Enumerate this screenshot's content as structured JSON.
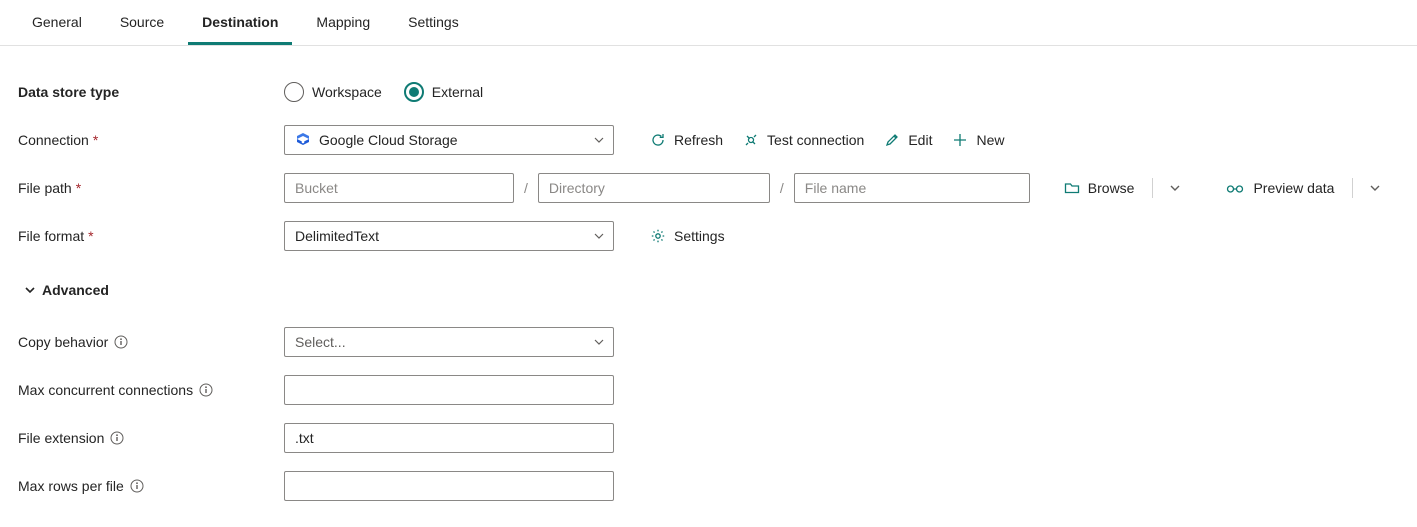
{
  "tabs": [
    "General",
    "Source",
    "Destination",
    "Mapping",
    "Settings"
  ],
  "active_tab_index": 2,
  "form": {
    "data_store_type": {
      "label": "Data store type",
      "options": [
        "Workspace",
        "External"
      ],
      "selected_index": 1
    },
    "connection": {
      "label": "Connection",
      "value": "Google Cloud Storage",
      "actions": {
        "refresh": "Refresh",
        "test": "Test connection",
        "edit": "Edit",
        "new": "New"
      }
    },
    "file_path": {
      "label": "File path",
      "bucket_placeholder": "Bucket",
      "bucket_value": "",
      "directory_placeholder": "Directory",
      "directory_value": "",
      "filename_placeholder": "File name",
      "filename_value": "",
      "browse": "Browse",
      "preview": "Preview data"
    },
    "file_format": {
      "label": "File format",
      "value": "DelimitedText",
      "settings": "Settings"
    },
    "advanced_label": "Advanced",
    "copy_behavior": {
      "label": "Copy behavior",
      "placeholder": "Select..."
    },
    "max_concurrent": {
      "label": "Max concurrent connections",
      "value": ""
    },
    "file_extension": {
      "label": "File extension",
      "value": ".txt"
    },
    "max_rows": {
      "label": "Max rows per file",
      "value": ""
    }
  }
}
